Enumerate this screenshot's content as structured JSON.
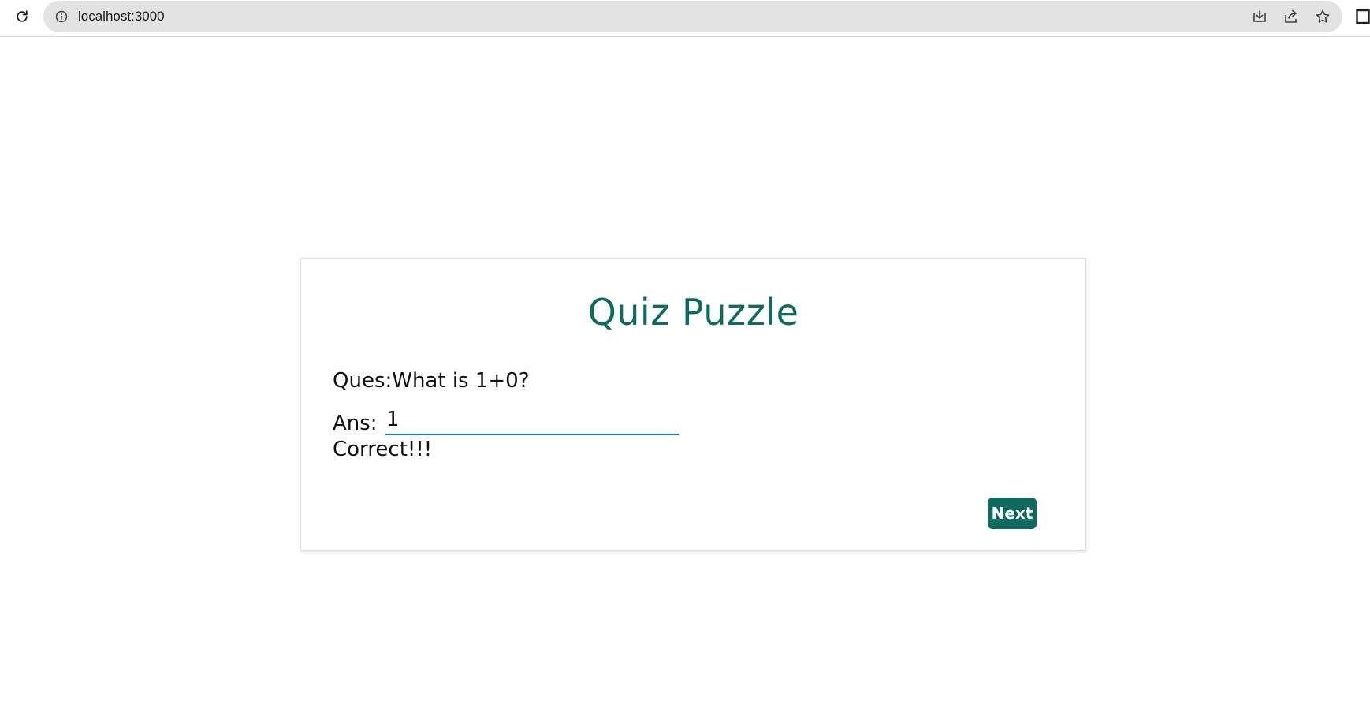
{
  "browser": {
    "url": "localhost:3000",
    "icons": [
      "reload-icon",
      "site-info-icon",
      "install-app-icon",
      "share-icon",
      "bookmark-star-icon",
      "side-panel-icon"
    ]
  },
  "quiz": {
    "title": "Quiz Puzzle",
    "question": "Ques:What is 1+0?",
    "answer_label": "Ans:",
    "answer_value": "1",
    "feedback": "Correct!!!",
    "next_label": "Next"
  },
  "colors": {
    "accent": "#0f6b5e",
    "input_underline": "#1a73e8"
  }
}
